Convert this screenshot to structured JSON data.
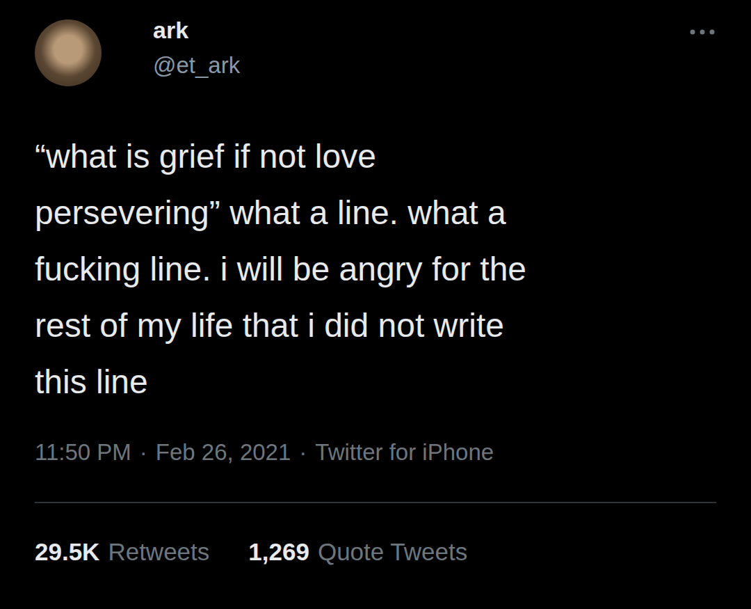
{
  "author": {
    "name": "ark",
    "handle": "@et_ark"
  },
  "tweet": {
    "lines": [
      "“what is grief if not love",
      "persevering” what a line. what a",
      "fucking line. i will be angry for the",
      "rest of my life that i did not write",
      "this line"
    ]
  },
  "meta": {
    "time": "11:50 PM",
    "date": "Feb 26, 2021",
    "source": "Twitter for iPhone",
    "separator": "·"
  },
  "stats": [
    {
      "count": "29.5K",
      "label": "Retweets"
    },
    {
      "count": "1,269",
      "label": "Quote Tweets"
    }
  ]
}
